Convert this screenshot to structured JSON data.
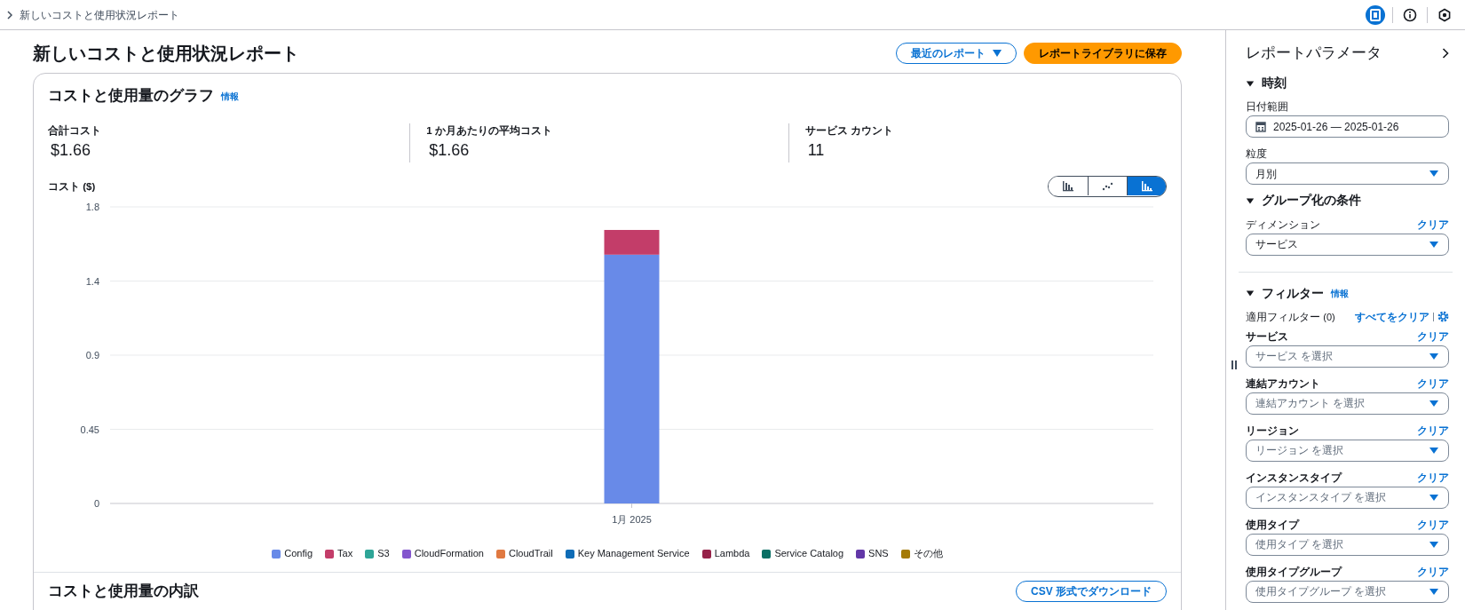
{
  "breadcrumb": {
    "text": "新しいコストと使用状況レポート"
  },
  "toolbar_icons": [
    {
      "kind": "panel",
      "selected": true
    },
    {
      "kind": "info",
      "selected": false
    },
    {
      "kind": "hex",
      "selected": false
    }
  ],
  "header": {
    "title": "新しいコストと使用状況レポート",
    "recent_button": "最近のレポート",
    "save_button": "レポートライブラリに保存"
  },
  "graph_card": {
    "title": "コストと使用量のグラフ",
    "info_link": "情報",
    "metrics": [
      {
        "label": "合計コスト",
        "value": "$1.66"
      },
      {
        "label": "1 か月あたりの平均コスト",
        "value": "$1.66"
      },
      {
        "label": "サービス カウント",
        "value": "11"
      }
    ],
    "chart_types": [
      {
        "kind": "bar",
        "selected": false
      },
      {
        "kind": "line",
        "selected": false
      },
      {
        "kind": "stacked",
        "selected": true
      }
    ],
    "chart_data": {
      "type": "bar",
      "stacked": true,
      "grid": true,
      "legend": true,
      "ylabel": "コスト ($)",
      "categories": [
        "1月 2025"
      ],
      "ylim": [
        0,
        1.8
      ],
      "yticks": [
        0,
        0.45,
        0.9,
        {
          "value": 1.35,
          "label": "1.4"
        },
        1.8
      ],
      "series": [
        {
          "name": "Config",
          "color": "#688ae8",
          "values": [
            1.51
          ]
        },
        {
          "name": "Tax",
          "color": "#c33d69",
          "values": [
            0.15
          ]
        },
        {
          "name": "S3",
          "color": "#2ea597",
          "values": [
            0
          ]
        },
        {
          "name": "CloudFormation",
          "color": "#8456ce",
          "values": [
            0
          ]
        },
        {
          "name": "CloudTrail",
          "color": "#e07941",
          "values": [
            0
          ]
        },
        {
          "name": "Key Management Service",
          "color": "#0f6cb6",
          "values": [
            0
          ]
        },
        {
          "name": "Lambda",
          "color": "#962249",
          "values": [
            0
          ]
        },
        {
          "name": "Service Catalog",
          "color": "#096f64",
          "values": [
            0
          ]
        },
        {
          "name": "SNS",
          "color": "#6237a7",
          "values": [
            0
          ]
        },
        {
          "name": "その他",
          "color": "#a47a04",
          "values": [
            0
          ]
        }
      ]
    }
  },
  "breakdown": {
    "title": "コストと使用量の内訳",
    "csv_button": "CSV 形式でダウンロード"
  },
  "panel": {
    "title": "レポートパラメータ",
    "time": {
      "title": "時刻",
      "expanded": true,
      "date_label": "日付範囲",
      "date_value": "2025-01-26 — 2025-01-26",
      "granularity_label": "粒度",
      "granularity_value": "月別"
    },
    "group": {
      "title": "グループ化の条件",
      "expanded": true,
      "dimension_label": "ディメンション",
      "clear": "クリア",
      "dimension_value": "サービス"
    },
    "filters": {
      "title": "フィルター",
      "expanded": true,
      "info_link": "情報",
      "applied_label": "適用フィルター",
      "applied_count": "(0)",
      "clear_all": "すべてをクリア",
      "items": [
        {
          "label": "サービス",
          "clear": "クリア",
          "placeholder": "サービス を選択"
        },
        {
          "label": "連結アカウント",
          "clear": "クリア",
          "placeholder": "連結アカウント を選択"
        },
        {
          "label": "リージョン",
          "clear": "クリア",
          "placeholder": "リージョン を選択"
        },
        {
          "label": "インスタンスタイプ",
          "clear": "クリア",
          "placeholder": "インスタンスタイプ を選択"
        },
        {
          "label": "使用タイプ",
          "clear": "クリア",
          "placeholder": "使用タイプ を選択"
        },
        {
          "label": "使用タイプグループ",
          "clear": "クリア",
          "placeholder": "使用タイプグループ を選択"
        }
      ]
    }
  }
}
